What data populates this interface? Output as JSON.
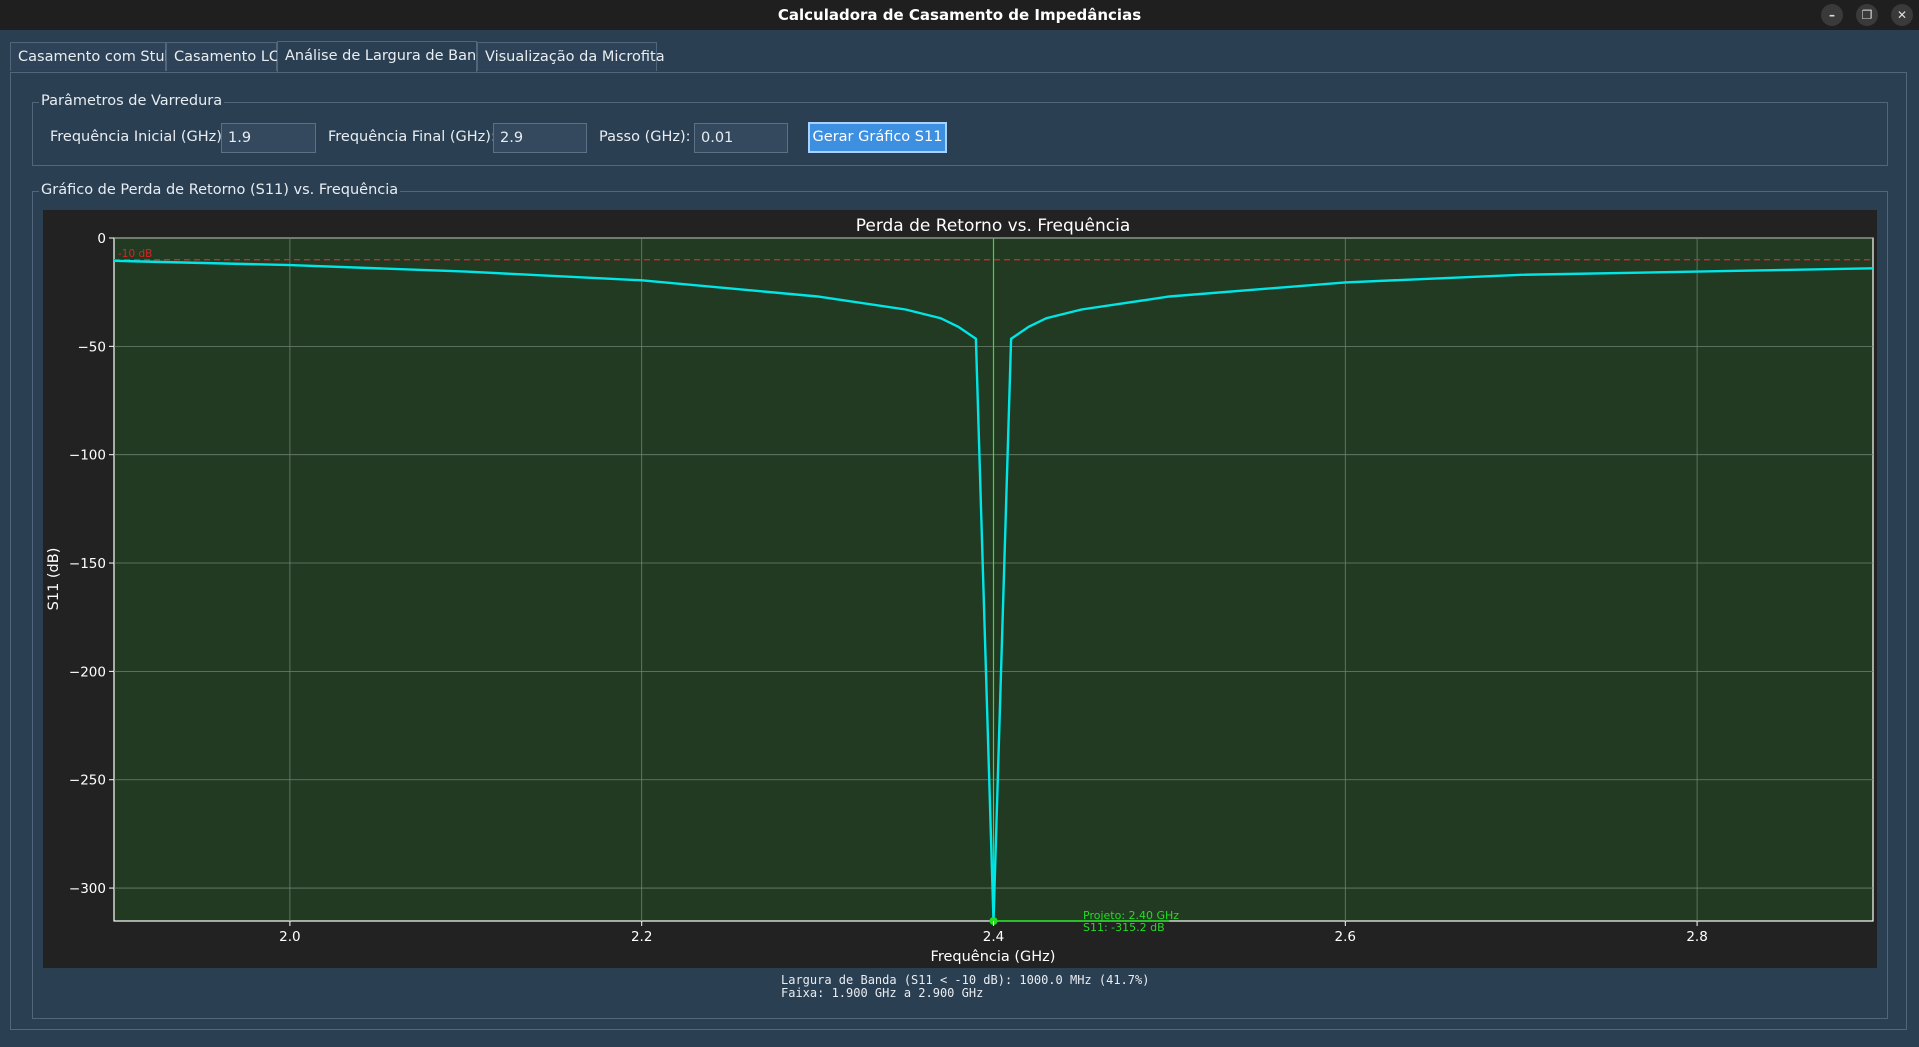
{
  "window": {
    "title": "Calculadora de Casamento de Impedâncias",
    "controls": {
      "minimize": "–",
      "maximize": "❐",
      "close": "✕"
    }
  },
  "tabs": [
    {
      "label": "Casamento com Stub"
    },
    {
      "label": "Casamento LC"
    },
    {
      "label": "Análise de Largura de Banda"
    },
    {
      "label": "Visualização da Microfita"
    }
  ],
  "sweep": {
    "group_title": "Parâmetros de Varredura",
    "start_label": "Frequência Inicial (GHz):",
    "start_value": "1.9",
    "end_label": "Frequência Final (GHz):",
    "end_value": "2.9",
    "step_label": "Passo (GHz):",
    "step_value": "0.01",
    "generate_button": "Gerar Gráfico S11"
  },
  "plot_group": {
    "title": "Gráfico de Perda de Retorno (S11) vs. Frequência"
  },
  "chart_data": {
    "type": "line",
    "title": "Perda de Retorno vs. Frequência",
    "xlabel": "Frequência (GHz)",
    "ylabel": "S11 (dB)",
    "xlim": [
      1.9,
      2.9
    ],
    "ylim": [
      -315.2,
      0
    ],
    "xticks": [
      2.0,
      2.2,
      2.4,
      2.6,
      2.8
    ],
    "xtick_labels": [
      "2.0",
      "2.2",
      "2.4",
      "2.6",
      "2.8"
    ],
    "yticks": [
      0,
      -50,
      -100,
      -150,
      -200,
      -250,
      -300
    ],
    "ytick_labels": [
      "0",
      "−50",
      "−100",
      "−150",
      "−200",
      "−250",
      "−300"
    ],
    "grid": true,
    "background": "#223a22",
    "series": [
      {
        "color": "#00e5e5",
        "x": [
          1.9,
          2.0,
          2.1,
          2.2,
          2.3,
          2.35,
          2.37,
          2.38,
          2.39,
          2.4,
          2.41,
          2.42,
          2.43,
          2.45,
          2.5,
          2.6,
          2.7,
          2.8,
          2.9
        ],
        "y": [
          -10.5,
          -12.5,
          -15.5,
          -19.5,
          -27,
          -33,
          -37,
          -41,
          -46.5,
          -315.2,
          -46.5,
          -41,
          -37,
          -33,
          -27,
          -20.5,
          -17,
          -15.5,
          -14
        ]
      },
      {
        "color": "#22dd22",
        "x": [
          2.4,
          2.5
        ],
        "y": [
          -315.2,
          -315.2
        ]
      }
    ],
    "reference_line": {
      "y": -10,
      "label": "-10 dB",
      "color": "#dd2222"
    },
    "marker_line": {
      "x": 2.4,
      "color": "#33dd33"
    },
    "annotation": {
      "x": 2.4,
      "y": -315.2,
      "line1": "Projeto: 2.40 GHz",
      "line2": "S11: -315.2 dB",
      "color": "#22dd22"
    }
  },
  "bandwidth": {
    "line1": "Largura de Banda (S11 < -10 dB): 1000.0 MHz (41.7%)",
    "line2": "Faixa: 1.900 GHz a 2.900 GHz"
  }
}
